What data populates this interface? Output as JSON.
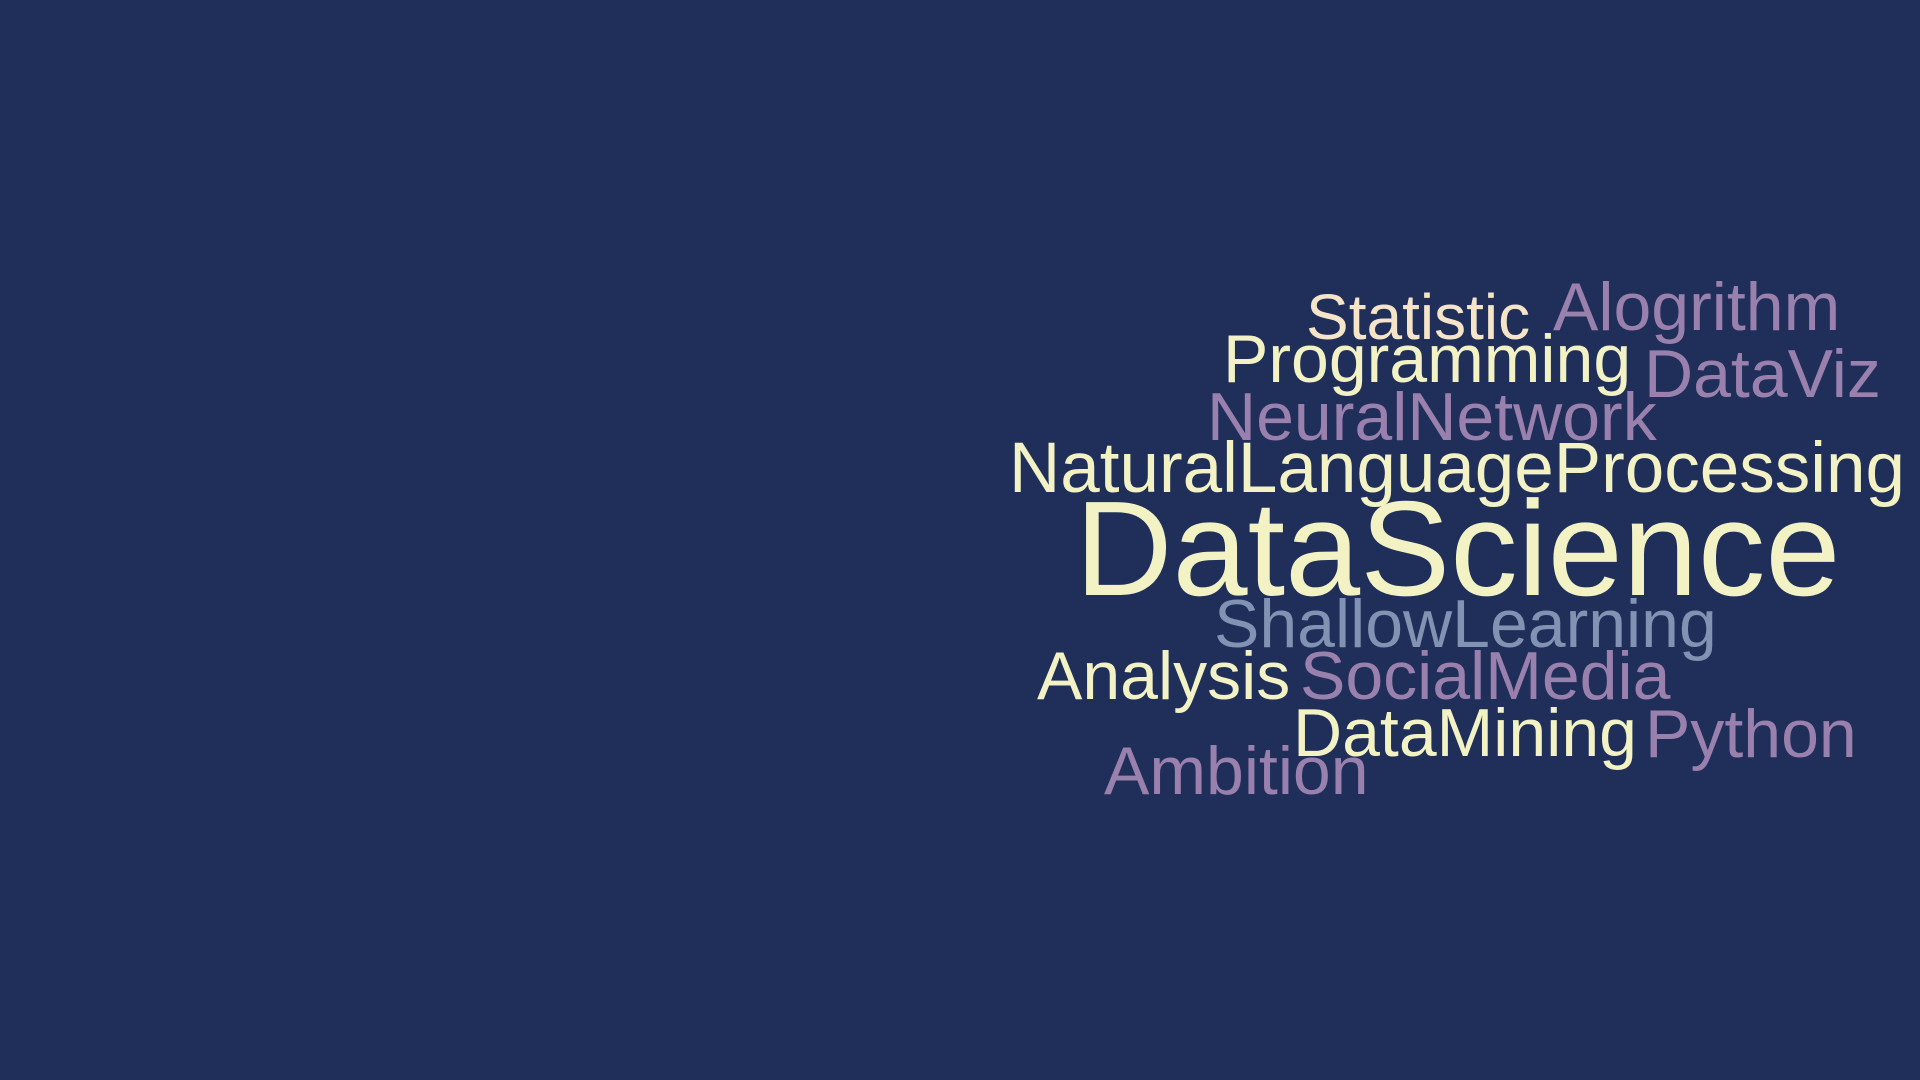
{
  "colors": {
    "background": "#1f2f5a",
    "cream": "#f2f2c4",
    "peach": "#f6e4c8",
    "purple": "#9a80ad",
    "slate": "#8192b3"
  },
  "words": {
    "statistic": {
      "text": "Statistic",
      "color": "#f6e4c8"
    },
    "alogrithm": {
      "text": "Alogrithm",
      "color": "#9a80ad"
    },
    "programming": {
      "text": "Programming",
      "color": "#f2f2c4"
    },
    "dataviz": {
      "text": "DataViz",
      "color": "#9a80ad"
    },
    "neural": {
      "text": "NeuralNetwork",
      "color": "#9a80ad"
    },
    "nlp": {
      "text": "NaturalLanguageProcessing",
      "color": "#f2f2c4"
    },
    "datascience": {
      "text": "DataScience",
      "color": "#f2f2c4"
    },
    "shallow": {
      "text": "ShallowLearning",
      "color": "#8192b3"
    },
    "analysis": {
      "text": "Analysis",
      "color": "#f2f2c4"
    },
    "social": {
      "text": "SocialMedia",
      "color": "#9a80ad"
    },
    "datamining": {
      "text": "DataMining",
      "color": "#f2f2c4"
    },
    "python": {
      "text": "Python",
      "color": "#9a80ad"
    },
    "ambition": {
      "text": "Ambition",
      "color": "#9a80ad"
    }
  }
}
